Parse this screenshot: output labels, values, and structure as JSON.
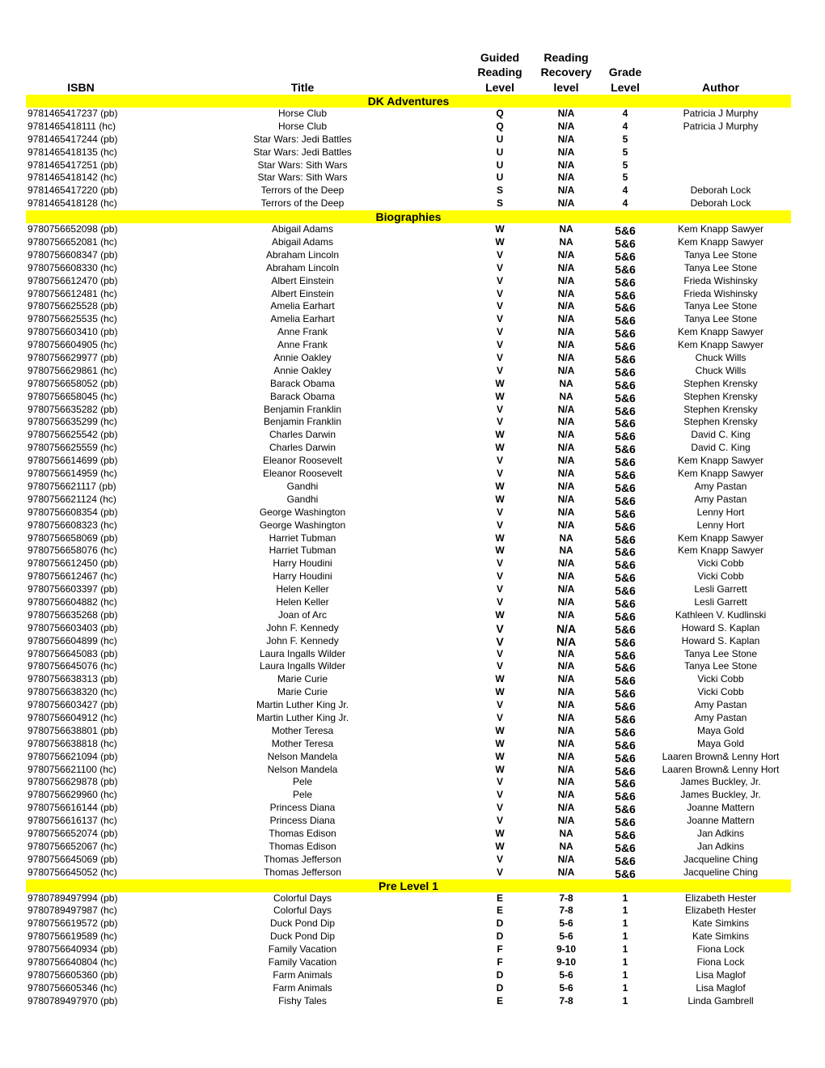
{
  "headers": {
    "isbn": "ISBN",
    "title": "Title",
    "guided_reading_level": [
      "Guided",
      "Reading",
      "Level"
    ],
    "reading_recovery_level": [
      "Reading",
      "Recovery",
      "level"
    ],
    "grade_level": [
      "Grade",
      "Level"
    ],
    "author": "Author"
  },
  "colors": {
    "section_band": "#ffff00"
  },
  "sections": [
    {
      "name": "DK Adventures",
      "rows": [
        [
          "9781465417237 (pb)",
          "Horse Club",
          "Q",
          "N/A",
          "4",
          "Patricia J Murphy"
        ],
        [
          "9781465418111 (hc)",
          "Horse Club",
          "Q",
          "N/A",
          "4",
          "Patricia J Murphy"
        ],
        [
          "9781465417244 (pb)",
          "Star Wars: Jedi Battles",
          "U",
          "N/A",
          "5",
          ""
        ],
        [
          "9781465418135 (hc)",
          "Star Wars: Jedi Battles",
          "U",
          "N/A",
          "5",
          ""
        ],
        [
          "9781465417251 (pb)",
          "Star Wars: Sith Wars",
          "U",
          "N/A",
          "5",
          ""
        ],
        [
          "9781465418142 (hc)",
          "Star Wars: Sith Wars",
          "U",
          "N/A",
          "5",
          ""
        ],
        [
          "9781465417220 (pb)",
          "Terrors of the Deep",
          "S",
          "N/A",
          "4",
          "Deborah Lock"
        ],
        [
          "9781465418128 (hc)",
          "Terrors of the Deep",
          "S",
          "N/A",
          "4",
          "Deborah Lock"
        ]
      ]
    },
    {
      "name": "Biographies",
      "rows": [
        [
          "9780756652098 (pb)",
          "Abigail Adams",
          "W",
          "NA",
          "5&6",
          "Kem Knapp Sawyer"
        ],
        [
          "9780756652081 (hc)",
          "Abigail Adams",
          "W",
          "NA",
          "5&6",
          "Kem Knapp Sawyer"
        ],
        [
          "9780756608347 (pb)",
          "Abraham Lincoln",
          "V",
          "N/A",
          "5&6",
          "Tanya Lee Stone"
        ],
        [
          "9780756608330 (hc)",
          "Abraham Lincoln",
          "V",
          "N/A",
          "5&6",
          "Tanya Lee Stone"
        ],
        [
          "9780756612470 (pb)",
          "Albert Einstein",
          "V",
          "N/A",
          "5&6",
          "Frieda Wishinsky"
        ],
        [
          "9780756612481 (hc)",
          "Albert Einstein",
          "V",
          "N/A",
          "5&6",
          "Frieda Wishinsky"
        ],
        [
          "9780756625528 (pb)",
          "Amelia Earhart",
          "V",
          "N/A",
          "5&6",
          "Tanya Lee Stone"
        ],
        [
          "9780756625535 (hc)",
          "Amelia Earhart",
          "V",
          "N/A",
          "5&6",
          "Tanya Lee Stone"
        ],
        [
          "9780756603410 (pb)",
          "Anne Frank",
          "V",
          "N/A",
          "5&6",
          "Kem Knapp Sawyer"
        ],
        [
          "9780756604905 (hc)",
          "Anne Frank",
          "V",
          "N/A",
          "5&6",
          "Kem Knapp Sawyer"
        ],
        [
          "9780756629977 (pb)",
          "Annie Oakley",
          "V",
          "N/A",
          "5&6",
          "Chuck Wills"
        ],
        [
          "9780756629861 (hc)",
          "Annie Oakley",
          "V",
          "N/A",
          "5&6",
          "Chuck Wills"
        ],
        [
          "9780756658052 (pb)",
          "Barack Obama",
          "W",
          "NA",
          "5&6",
          "Stephen Krensky"
        ],
        [
          "9780756658045 (hc)",
          "Barack Obama",
          "W",
          "NA",
          "5&6",
          "Stephen Krensky"
        ],
        [
          "9780756635282 (pb)",
          "Benjamin Franklin",
          "V",
          "N/A",
          "5&6",
          "Stephen Krensky"
        ],
        [
          "9780756635299 (hc)",
          "Benjamin Franklin",
          "V",
          "N/A",
          "5&6",
          "Stephen Krensky"
        ],
        [
          "9780756625542 (pb)",
          "Charles Darwin",
          "W",
          "N/A",
          "5&6",
          "David C. King"
        ],
        [
          "9780756625559 (hc)",
          "Charles Darwin",
          "W",
          "N/A",
          "5&6",
          "David C. King"
        ],
        [
          "9780756614699 (pb)",
          "Eleanor Roosevelt",
          "V",
          "N/A",
          "5&6",
          "Kem Knapp Sawyer"
        ],
        [
          "9780756614959 (hc)",
          "Eleanor Roosevelt",
          "V",
          "N/A",
          "5&6",
          "Kem Knapp Sawyer"
        ],
        [
          "9780756621117 (pb)",
          "Gandhi",
          "W",
          "N/A",
          "5&6",
          "Amy Pastan"
        ],
        [
          "9780756621124 (hc)",
          "Gandhi",
          "W",
          "N/A",
          "5&6",
          "Amy Pastan"
        ],
        [
          "9780756608354 (pb)",
          "George Washington",
          "V",
          "N/A",
          "5&6",
          "Lenny Hort"
        ],
        [
          "9780756608323 (hc)",
          "George Washington",
          "V",
          "N/A",
          "5&6",
          "Lenny Hort"
        ],
        [
          "9780756658069 (pb)",
          "Harriet Tubman",
          "W",
          "NA",
          "5&6",
          "Kem Knapp Sawyer"
        ],
        [
          "9780756658076 (hc)",
          "Harriet Tubman",
          "W",
          "NA",
          "5&6",
          "Kem Knapp Sawyer"
        ],
        [
          "9780756612450 (pb)",
          "Harry Houdini",
          "V",
          "N/A",
          "5&6",
          "Vicki Cobb"
        ],
        [
          "9780756612467 (hc)",
          "Harry Houdini",
          "V",
          "N/A",
          "5&6",
          "Vicki Cobb"
        ],
        [
          "9780756603397 (pb)",
          "Helen Keller",
          "V",
          "N/A",
          "5&6",
          "Lesli Garrett"
        ],
        [
          "9780756604882 (hc)",
          "Helen Keller",
          "V",
          "N/A",
          "5&6",
          "Lesli Garrett"
        ],
        [
          "9780756635268 (pb)",
          "Joan of Arc",
          "W",
          "N/A",
          "5&6",
          "Kathleen V. Kudlinski"
        ],
        [
          "9780756603403 (pb)",
          "John F. Kennedy",
          "V",
          "N/A",
          "5&6",
          "Howard S. Kaplan"
        ],
        [
          "9780756604899 (hc)",
          "John F. Kennedy",
          "V",
          "N/A",
          "5&6",
          "Howard S. Kaplan"
        ],
        [
          "9780756645083 (pb)",
          "Laura Ingalls Wilder",
          "V",
          "N/A",
          "5&6",
          "Tanya Lee Stone"
        ],
        [
          "9780756645076 (hc)",
          "Laura Ingalls Wilder",
          "V",
          "N/A",
          "5&6",
          "Tanya Lee Stone"
        ],
        [
          "9780756638313 (pb)",
          "Marie Curie",
          "W",
          "N/A",
          "5&6",
          "Vicki Cobb"
        ],
        [
          "9780756638320 (hc)",
          "Marie Curie",
          "W",
          "N/A",
          "5&6",
          "Vicki Cobb"
        ],
        [
          "9780756603427 (pb)",
          "Martin Luther King Jr.",
          "V",
          "N/A",
          "5&6",
          "Amy Pastan"
        ],
        [
          "9780756604912 (hc)",
          "Martin Luther King Jr.",
          "V",
          "N/A",
          "5&6",
          "Amy Pastan"
        ],
        [
          "9780756638801 (pb)",
          "Mother Teresa",
          "W",
          "N/A",
          "5&6",
          "Maya Gold"
        ],
        [
          "9780756638818 (hc)",
          "Mother Teresa",
          "W",
          "N/A",
          "5&6",
          "Maya Gold"
        ],
        [
          "9780756621094 (pb)",
          "Nelson Mandela",
          "W",
          "N/A",
          "5&6",
          "Laaren Brown& Lenny Hort"
        ],
        [
          "9780756621100 (hc)",
          "Nelson Mandela",
          "W",
          "N/A",
          "5&6",
          "Laaren Brown& Lenny Hort"
        ],
        [
          "9780756629878 (pb)",
          "Pele",
          "V",
          "N/A",
          "5&6",
          "James Buckley, Jr."
        ],
        [
          "9780756629960 (hc)",
          "Pele",
          "V",
          "N/A",
          "5&6",
          "James Buckley, Jr."
        ],
        [
          "9780756616144 (pb)",
          "Princess Diana",
          "V",
          "N/A",
          "5&6",
          "Joanne Mattern"
        ],
        [
          "9780756616137 (hc)",
          "Princess Diana",
          "V",
          "N/A",
          "5&6",
          "Joanne Mattern"
        ],
        [
          "9780756652074 (pb)",
          "Thomas Edison",
          "W",
          "NA",
          "5&6",
          "Jan Adkins"
        ],
        [
          "9780756652067 (hc)",
          "Thomas Edison",
          "W",
          "NA",
          "5&6",
          "Jan Adkins"
        ],
        [
          "9780756645069 (pb)",
          "Thomas Jefferson",
          "V",
          "N/A",
          "5&6",
          "Jacqueline Ching"
        ],
        [
          "9780756645052 (hc)",
          "Thomas Jefferson",
          "V",
          "N/A",
          "5&6",
          "Jacqueline Ching"
        ]
      ]
    },
    {
      "name": "Pre Level 1",
      "rows": [
        [
          "9780789497994 (pb)",
          "Colorful Days",
          "E",
          "7-8",
          "1",
          "Elizabeth Hester"
        ],
        [
          "9780789497987 (hc)",
          "Colorful Days",
          "E",
          "7-8",
          "1",
          "Elizabeth Hester"
        ],
        [
          "9780756619572 (pb)",
          "Duck Pond Dip",
          "D",
          "5-6",
          "1",
          "Kate Simkins"
        ],
        [
          "9780756619589 (hc)",
          "Duck Pond Dip",
          "D",
          "5-6",
          "1",
          "Kate Simkins"
        ],
        [
          "9780756640934 (pb)",
          "Family Vacation",
          "F",
          "9-10",
          "1",
          "Fiona Lock"
        ],
        [
          "9780756640804 (hc)",
          "Family Vacation",
          "F",
          "9-10",
          "1",
          "Fiona Lock"
        ],
        [
          "9780756605360 (pb)",
          "Farm Animals",
          "D",
          "5-6",
          "1",
          "Lisa Maglof"
        ],
        [
          "9780756605346 (hc)",
          "Farm Animals",
          "D",
          "5-6",
          "1",
          "Lisa Maglof"
        ],
        [
          "9780789497970 (pb)",
          "Fishy Tales",
          "E",
          "7-8",
          "1",
          "Linda Gambrell"
        ]
      ]
    }
  ]
}
